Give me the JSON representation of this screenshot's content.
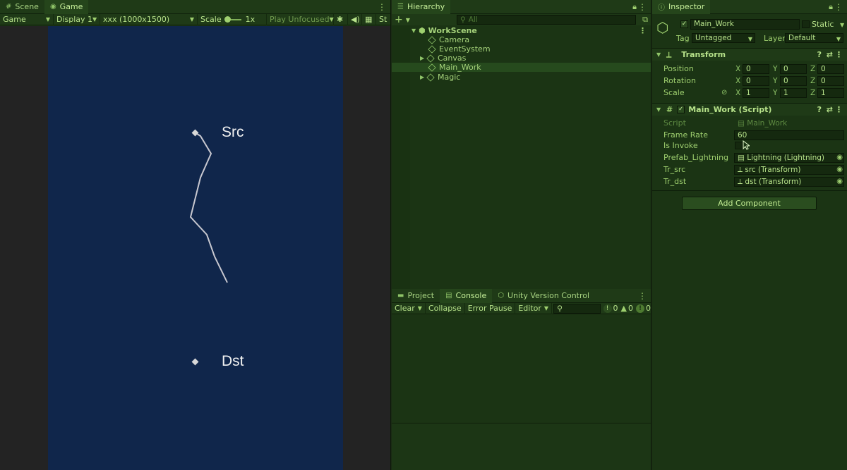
{
  "game_panel": {
    "tabs": [
      {
        "label": "Scene",
        "icon": "grid-icon"
      },
      {
        "label": "Game",
        "icon": "gamepad-icon"
      }
    ],
    "toolbar": {
      "mode": "Game",
      "display": "Display 1",
      "resolution": "xxx (1000x1500)",
      "scale_label": "Scale",
      "scale_value": "1x",
      "play_mode": "Play Unfocused",
      "stats_short": "St"
    },
    "scene": {
      "src_label": "Src",
      "dst_label": "Dst",
      "line_color": "#c8c8d0",
      "background": "#10264b"
    }
  },
  "hierarchy": {
    "title": "Hierarchy",
    "search_placeholder": "All",
    "scene": "WorkScene",
    "items": [
      {
        "label": "Camera",
        "expandable": false,
        "selected": false
      },
      {
        "label": "EventSystem",
        "expandable": false,
        "selected": false
      },
      {
        "label": "Canvas",
        "expandable": true,
        "selected": false
      },
      {
        "label": "Main_Work",
        "expandable": false,
        "selected": true
      },
      {
        "label": "Magic",
        "expandable": true,
        "selected": false
      }
    ]
  },
  "console": {
    "tabs": [
      {
        "label": "Project",
        "icon": "folder-icon"
      },
      {
        "label": "Console",
        "icon": "console-icon"
      },
      {
        "label": "Unity Version Control",
        "icon": "version-control-icon"
      }
    ],
    "toolbar": {
      "clear": "Clear",
      "collapse": "Collapse",
      "error_pause": "Error Pause",
      "editor": "Editor",
      "info_count": "0",
      "warning_count": "0",
      "error_count": "0"
    }
  },
  "inspector": {
    "title": "Inspector",
    "object_name": "Main_Work",
    "static_label": "Static",
    "tag_label": "Tag",
    "tag_value": "Untagged",
    "layer_label": "Layer",
    "layer_value": "Default",
    "transform": {
      "title": "Transform",
      "position": {
        "label": "Position",
        "x": "0",
        "y": "0",
        "z": "0"
      },
      "rotation": {
        "label": "Rotation",
        "x": "0",
        "y": "0",
        "z": "0"
      },
      "scale": {
        "label": "Scale",
        "x": "1",
        "y": "1",
        "z": "1"
      }
    },
    "script": {
      "title": "Main_Work (Script)",
      "fields": {
        "script_label": "Script",
        "script_value": "Main_Work",
        "frame_rate_label": "Frame Rate",
        "frame_rate_value": "60",
        "is_invoke_label": "Is Invoke",
        "prefab_label": "Prefab_Lightning",
        "prefab_value": "Lightning (Lightning)",
        "tr_src_label": "Tr_src",
        "tr_src_value": "src (Transform)",
        "tr_dst_label": "Tr_dst",
        "tr_dst_value": "dst (Transform)"
      }
    },
    "add_component": "Add Component",
    "axis_labels": {
      "x": "X",
      "y": "Y",
      "z": "Z"
    }
  }
}
